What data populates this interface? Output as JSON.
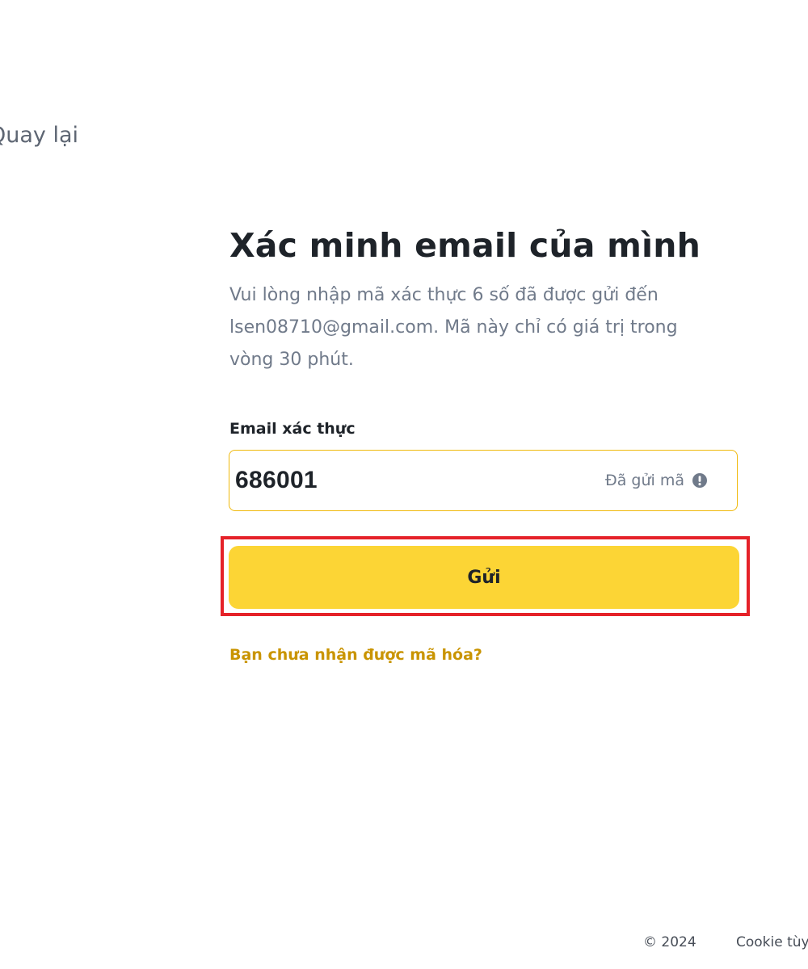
{
  "nav": {
    "back_label": "Quay lại"
  },
  "verify": {
    "title": "Xác minh email của mình",
    "description": "Vui lòng nhập mã xác thực 6 số đã được gửi đến lsen08710@gmail.com. Mã này chỉ có giá trị trong vòng 30 phút.",
    "field_label": "Email xác thực",
    "code_value": "686001",
    "sent_status": "Đã gửi mã",
    "status_icon": "info-circle-icon",
    "submit_label": "Gửi",
    "resend_link": "Bạn chưa nhận được mã hóa?"
  },
  "footer": {
    "copyright": "© 2024",
    "cookie_label": "Cookie tùy"
  },
  "colors": {
    "accent_yellow": "#fcd535",
    "field_border": "#f0b90b",
    "link_gold": "#c99400",
    "highlight_red": "#e52229",
    "muted_text": "#707a8a",
    "text_dark": "#1e2329"
  }
}
